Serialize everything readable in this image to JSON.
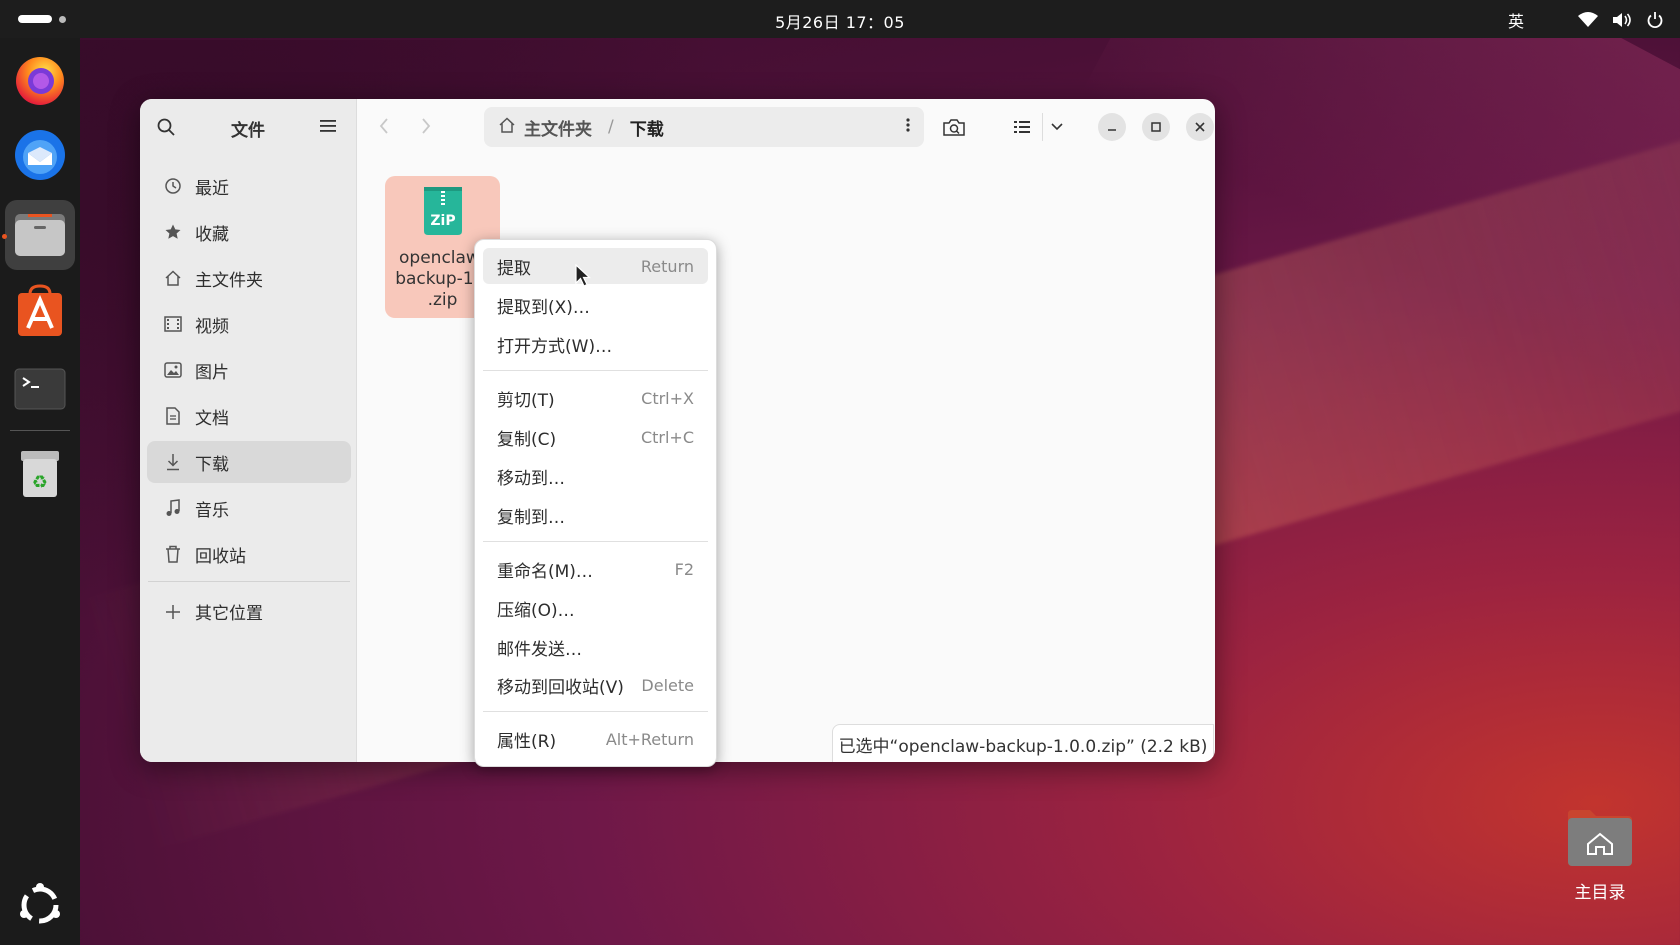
{
  "topbar": {
    "clock": "5月26日 17：05",
    "input_method": "英"
  },
  "dock": {
    "items": [
      "firefox-icon",
      "thunderbird-icon",
      "files-icon",
      "app-center-icon",
      "terminal-icon",
      "trash-icon",
      "show-apps-icon"
    ]
  },
  "desktop": {
    "home_label": "主目录"
  },
  "window": {
    "sidebar_title": "文件",
    "sidebar_items": [
      {
        "label": "最近",
        "icon": "clock-icon"
      },
      {
        "label": "收藏",
        "icon": "star-icon"
      },
      {
        "label": "主文件夹",
        "icon": "home-icon"
      },
      {
        "label": "视频",
        "icon": "video-icon"
      },
      {
        "label": "图片",
        "icon": "picture-icon"
      },
      {
        "label": "文档",
        "icon": "document-icon"
      },
      {
        "label": "下载",
        "icon": "download-icon",
        "active": true
      },
      {
        "label": "音乐",
        "icon": "music-icon"
      },
      {
        "label": "回收站",
        "icon": "trash-icon"
      }
    ],
    "other_places": "其它位置",
    "path": {
      "home": "主文件夹",
      "separator": "/",
      "current": "下载"
    },
    "file": {
      "name": "openclaw-\nbackup-1.0\n.zip",
      "icon_text": "ZiP"
    },
    "status": "已选中“openclaw-backup-1.0.0.zip” (2.2 kB)"
  },
  "context_menu": {
    "items": [
      {
        "label": "提取",
        "accel": "Return"
      },
      {
        "label": "提取到(X)…",
        "accel": ""
      },
      {
        "label": "打开方式(W)…",
        "accel": ""
      },
      {
        "label": "剪切(T)",
        "accel": "Ctrl+X"
      },
      {
        "label": "复制(C)",
        "accel": "Ctrl+C"
      },
      {
        "label": "移动到…",
        "accel": ""
      },
      {
        "label": "复制到…",
        "accel": ""
      },
      {
        "label": "重命名(M)…",
        "accel": "F2"
      },
      {
        "label": "压缩(O)…",
        "accel": ""
      },
      {
        "label": "邮件发送…",
        "accel": ""
      },
      {
        "label": "移动到回收站(V)",
        "accel": "Delete"
      },
      {
        "label": "属性(R)",
        "accel": "Alt+Return"
      }
    ]
  }
}
